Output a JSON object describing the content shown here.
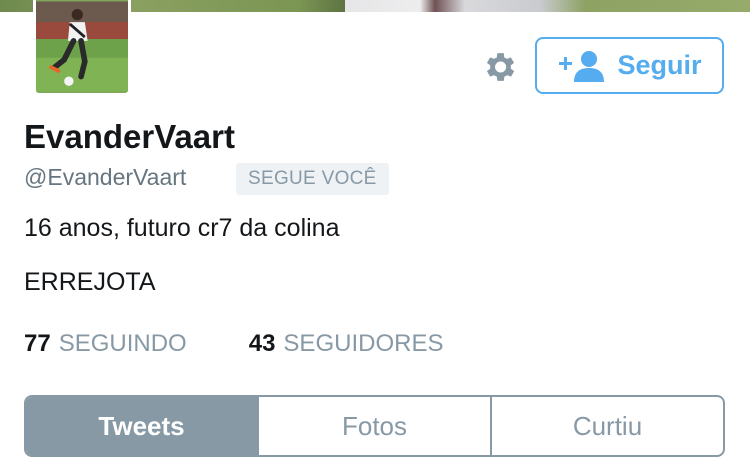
{
  "profile": {
    "display_name": "EvanderVaart",
    "handle": "@EvanderVaart",
    "follows_you_label": "SEGUE VOCÊ",
    "bio": "16 anos, futuro cr7 da colina",
    "location": "ERREJOTA"
  },
  "actions": {
    "follow_label": "Seguir",
    "settings_icon": "gear-icon",
    "follow_icon": "add-user-icon"
  },
  "stats": {
    "following_count": "77",
    "following_label": "SEGUINDO",
    "followers_count": "43",
    "followers_label": "SEGUIDORES"
  },
  "tabs": [
    {
      "label": "Tweets",
      "active": true
    },
    {
      "label": "Fotos",
      "active": false
    },
    {
      "label": "Curtiu",
      "active": false
    }
  ],
  "colors": {
    "accent": "#55acee",
    "muted": "#8899a6",
    "text": "#14171a"
  }
}
